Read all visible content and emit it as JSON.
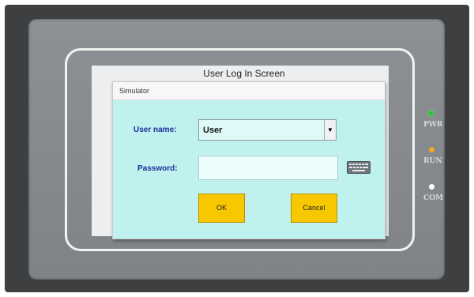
{
  "screen": {
    "title": "User Log In Screen"
  },
  "dialog": {
    "title": "Simulator",
    "username_label": "User name:",
    "username_value": "User",
    "password_label": "Password:",
    "password_value": "",
    "ok_label": "OK",
    "cancel_label": "Cancel",
    "background_color": "#bff2ef",
    "button_color": "#f7c800"
  },
  "indicators": [
    {
      "label": "PWR",
      "color": "#36c23a"
    },
    {
      "label": "RUN",
      "color": "#f5a623"
    },
    {
      "label": "COM",
      "color": "#ffffff"
    }
  ],
  "icons": {
    "dropdown": "chevron-down-icon",
    "keyboard": "keyboard-icon"
  }
}
